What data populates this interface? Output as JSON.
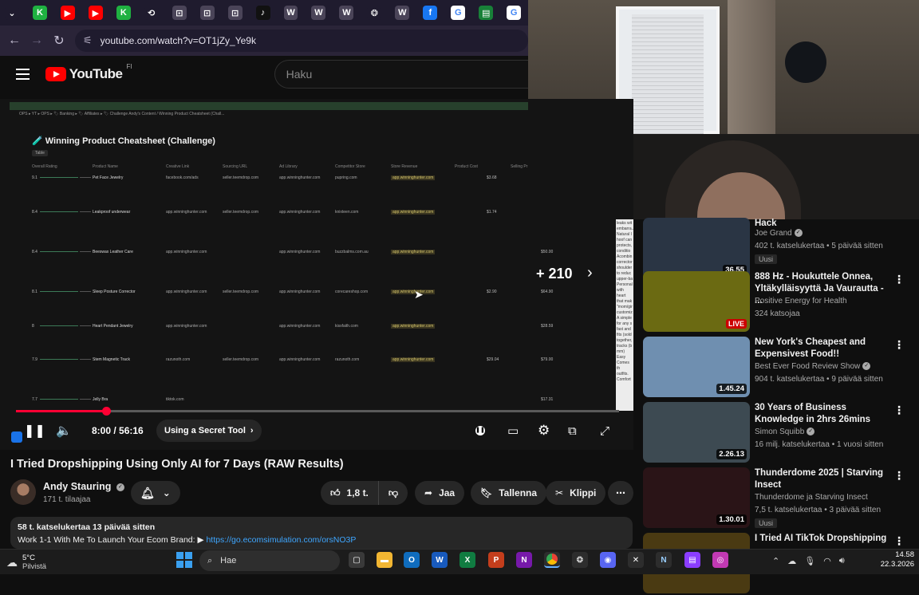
{
  "browser": {
    "url": "youtube.com/watch?v=OT1jZy_Ye9k",
    "tabs": [
      {
        "icon": "chevron-down-icon",
        "color": "#1f1b2e",
        "glyph": "⌄"
      },
      {
        "icon": "kajabi-icon",
        "color": "#1fb141",
        "glyph": "K"
      },
      {
        "icon": "youtube-icon",
        "color": "#ff0000",
        "glyph": "▶"
      },
      {
        "icon": "youtube-icon",
        "color": "#ff0000",
        "glyph": "▶"
      },
      {
        "icon": "kajabi-icon",
        "color": "#1fb141",
        "glyph": "K"
      },
      {
        "icon": "history-icon",
        "color": "#1f1b2e",
        "glyph": "⟲"
      },
      {
        "icon": "tab-icon",
        "color": "#4a4458",
        "glyph": "⊡"
      },
      {
        "icon": "tab-icon",
        "color": "#4a4458",
        "glyph": "⊡"
      },
      {
        "icon": "tab-icon",
        "color": "#4a4458",
        "glyph": "⊡"
      },
      {
        "icon": "tiktok-icon",
        "color": "#111111",
        "glyph": "♪"
      },
      {
        "icon": "wordpress-icon",
        "color": "#4a4458",
        "glyph": "W"
      },
      {
        "icon": "wordpress-icon",
        "color": "#4a4458",
        "glyph": "W"
      },
      {
        "icon": "wordpress-icon",
        "color": "#4a4458",
        "glyph": "W"
      },
      {
        "icon": "openai-icon",
        "color": "#1f1b2e",
        "glyph": "❂"
      },
      {
        "icon": "wordpress-icon",
        "color": "#4a4458",
        "glyph": "W"
      },
      {
        "icon": "facebook-icon",
        "color": "#1877f2",
        "glyph": "f"
      },
      {
        "icon": "google-icon",
        "color": "#ffffff",
        "glyph": "G"
      },
      {
        "icon": "sheets-icon",
        "color": "#188038",
        "glyph": "▤"
      },
      {
        "icon": "google-icon",
        "color": "#ffffff",
        "glyph": "G"
      }
    ]
  },
  "youtube": {
    "logo_text": "YouTube",
    "region": "FI",
    "search_placeholder": "Haku"
  },
  "video": {
    "sheet_crumb": "OPS  ▸ YT  ▸ OPS  ▸ 🏷 Banking  ▸ 🏷 Affiliates  ▸ 🏷 Challenge      Andy's Content  /  Winning Product Cheatsheet (Chall...",
    "sheet_title": "🧪 Winning Product Cheatsheet (Challenge)",
    "sheet_tag": "Table",
    "sheet_headers": [
      "Overall Rating",
      "Product Name",
      "Creative Link",
      "Sourcing URL",
      "Ad Library",
      "Competitor Store",
      "Store Revenue",
      "Product Cost",
      "Selling Pr"
    ],
    "rows": [
      {
        "score": "9.1",
        "name": "Pet Face Jewelry",
        "c1": "facebook.com/ads",
        "c2": "seller.teemdrop.com",
        "c3": "app.winninghunter.com",
        "c4": "pupring.com",
        "c5": "app.winninghunter.com",
        "c6": "$3.68",
        "c7": ""
      },
      {
        "score": "8.4",
        "name": "Leakproof underwear",
        "c1": "app.winninghunter.com",
        "c2": "seller.teemdrop.com",
        "c3": "app.winninghunter.com",
        "c4": "knixteen.com",
        "c5": "app.winninghunter.com",
        "c6": "$1.74",
        "c7": ""
      },
      {
        "score": "8.4",
        "name": "Beeswax Leather Care",
        "c1": "app.winninghunter.com",
        "c2": "",
        "c3": "app.winninghunter.com",
        "c4": "buzzbalms.com.au",
        "c5": "app.winninghunter.com",
        "c6": "",
        "c7": "$50.00"
      },
      {
        "score": "8.1",
        "name": "Sleep Posture Corrector",
        "c1": "app.winninghunter.com",
        "c2": "seller.teemdrop.com",
        "c3": "app.winninghunter.com",
        "c4": "corecareshop.com",
        "c5": "app.winninghunter.com",
        "c6": "$2.90",
        "c7": "$64.90"
      },
      {
        "score": "8",
        "name": "Heart Pendant Jewelry",
        "c1": "app.winninghunter.com",
        "c2": "",
        "c3": "app.winninghunter.com",
        "c4": "kissfaith.com",
        "c5": "app.winninghunter.com",
        "c6": "",
        "c7": "$28.59"
      },
      {
        "score": "7.9",
        "name": "Stem Magnetic Track",
        "c1": "razunoth.com",
        "c2": "seller.teemdrop.com",
        "c3": "app.winninghunter.com",
        "c4": "razunoth.com",
        "c5": "app.winninghunter.com",
        "c6": "$29.04",
        "c7": "$79.00"
      },
      {
        "score": "7.7",
        "name": "Jelly Bra",
        "c1": "tiktok.com",
        "c2": "",
        "c3": "",
        "c4": "",
        "c5": "",
        "c6": "",
        "c7": "$17.31"
      }
    ],
    "more_count": "+ 210",
    "progress_fraction": 0.15,
    "time": "8:00 / 56:16",
    "chapter": "Using a Secret Tool",
    "title": "I Tried Dropshipping Using Only AI for 7 Days (RAW Results)",
    "overlay_text": "leaks wit embarra... Natural I hoof can protects, conditio Acombin corrector shoulder to reduc upper-ba Personal with heart that mak \"mom/gir customiz A simple for any s fast and fits (sold together, tracks (b mm) Easy Comes th outfits. Comfort"
  },
  "channel": {
    "name": "Andy Stauring",
    "subs": "171 t. tilaajaa"
  },
  "actions": {
    "likes": "1,8 t.",
    "share": "Jaa",
    "save": "Tallenna",
    "clip": "Klippi"
  },
  "description": {
    "stats": "58 t. katselukertaa  13 päivää sitten",
    "text": "Work 1-1 With Me To Launch Your Ecom Brand: ▶ ",
    "link": "https://go.ecomsimulation.com/orsNO3P"
  },
  "recommendations": [
    {
      "title": "Hack",
      "channel": "Joe Grand",
      "verified": true,
      "meta": "402 t. katselukertaa • 5 päivää sitten",
      "badge": "Uusi",
      "duration": "36.55",
      "live": false,
      "bg": "#2a3544"
    },
    {
      "title": "888 Hz - Houkuttele Onnea, Yltäkylläisyyttä Ja Vaurautta - ...",
      "channel": "Positive Energy for Health",
      "verified": false,
      "meta": "324 katsojaa",
      "badge": "",
      "duration": "LIVE",
      "live": true,
      "bg": "#6b6a12"
    },
    {
      "title": "New York's Cheapest and Expensivest Food!!",
      "channel": "Best Ever Food Review Show",
      "verified": true,
      "meta": "904 t. katselukertaa • 9 päivää sitten",
      "badge": "",
      "duration": "1.45.24",
      "live": false,
      "bg": "#6f8fb0"
    },
    {
      "title": "30 Years of Business Knowledge in 2hrs 26mins",
      "channel": "Simon Squibb",
      "verified": true,
      "meta": "16 milj. katselukertaa • 1 vuosi sitten",
      "badge": "",
      "duration": "2.26.13",
      "live": false,
      "bg": "#3d4a52"
    },
    {
      "title": "Thunderdome 2025 | Starving Insect",
      "channel": "Thunderdome ja Starving Insect",
      "verified": false,
      "meta": "7,5 t. katselukertaa • 3 päivää sitten",
      "badge": "Uusi",
      "duration": "1.30.01",
      "live": false,
      "bg": "#2a1417"
    },
    {
      "title": "I Tried AI TikTok Dropshipping",
      "channel": "",
      "verified": false,
      "meta": "",
      "badge": "",
      "duration": "",
      "live": false,
      "bg": "#4a3a12"
    }
  ],
  "taskbar": {
    "temperature": "5°C",
    "condition": "Pilvistä",
    "search_placeholder": "Hae",
    "time": "14.58",
    "date": "22.3.2026"
  }
}
